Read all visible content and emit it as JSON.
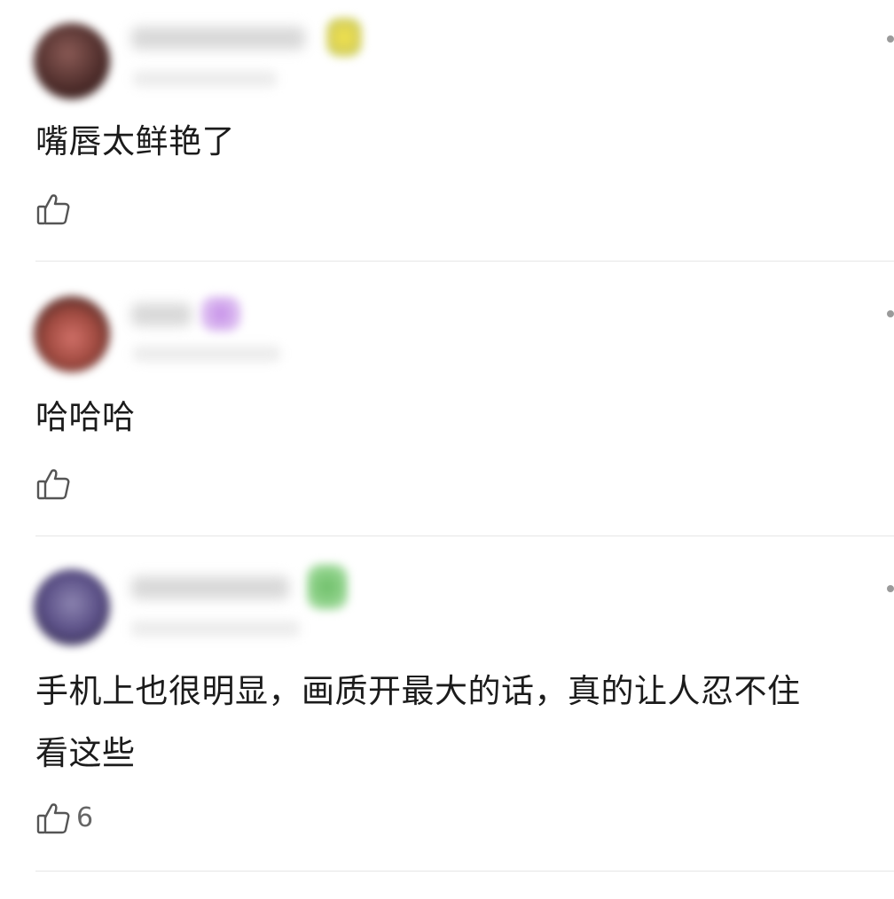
{
  "comments": [
    {
      "text": "嘴唇太鲜艳了",
      "like_icon": "thumbs-up-icon",
      "like_count": ""
    },
    {
      "text": "哈哈哈",
      "like_icon": "thumbs-up-icon",
      "like_count": ""
    },
    {
      "text_line1": "手机上也很明显，画质开最大的话，真的让人忍不住",
      "text_line2": "看这些",
      "like_icon": "thumbs-up-icon",
      "like_count": "6"
    }
  ],
  "colors": {
    "text": "#1b1b1b",
    "divider": "#e6e6e6",
    "like_count": "#666666",
    "icon_stroke": "#555555"
  }
}
